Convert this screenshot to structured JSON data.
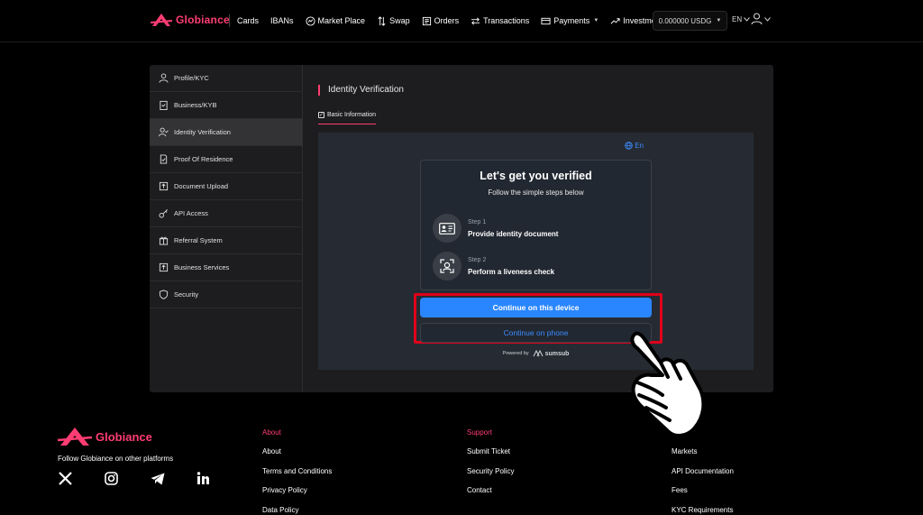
{
  "brand": {
    "name": "Globiance"
  },
  "nav": {
    "cards": "Cards",
    "ibans": "IBANs",
    "market_place": "Market Place",
    "swap": "Swap",
    "orders": "Orders",
    "transactions": "Transactions",
    "payments": "Payments",
    "investments": "Investments",
    "balance": "0.000000 USDG",
    "language": "EN"
  },
  "sidebar": {
    "items": [
      {
        "label": "Profile/KYC",
        "icon": "user-icon"
      },
      {
        "label": "Business/KYB",
        "icon": "clipboard-icon"
      },
      {
        "label": "Identity Verification",
        "icon": "user-check-icon"
      },
      {
        "label": "Proof Of Residence",
        "icon": "document-check-icon"
      },
      {
        "label": "Document Upload",
        "icon": "upload-icon"
      },
      {
        "label": "API Access",
        "icon": "key-icon"
      },
      {
        "label": "Referral System",
        "icon": "gift-icon"
      },
      {
        "label": "Business Services",
        "icon": "upload-icon"
      },
      {
        "label": "Security",
        "icon": "shield-icon"
      }
    ]
  },
  "content": {
    "title": "Identity Verification",
    "tab": "Basic Information"
  },
  "widget": {
    "language": "En",
    "title": "Let's get you verified",
    "subtitle": "Follow the simple steps below",
    "steps": [
      {
        "num": "Step 1",
        "text": "Provide identity document",
        "icon": "id-card-icon"
      },
      {
        "num": "Step 2",
        "text": "Perform a liveness check",
        "icon": "face-scan-icon"
      }
    ],
    "primary_button": "Continue on this device",
    "secondary_button": "Continue on phone",
    "powered_by": "Powered by",
    "powered_brand": "sumsub"
  },
  "colors": {
    "brand": "#ff3d73",
    "primary_button": "#2a86ff",
    "highlight": "#e0001a"
  },
  "footer": {
    "brand": "Globiance",
    "follow": "Follow Globiance on other platforms",
    "socials": [
      "x-icon",
      "instagram-icon",
      "telegram-icon",
      "linkedin-icon"
    ],
    "about": {
      "heading": "About",
      "links": [
        "About",
        "Terms and Conditions",
        "Privacy Policy",
        "Data Policy"
      ]
    },
    "support": {
      "heading": "Support",
      "links": [
        "Submit Ticket",
        "Security Policy",
        "Contact"
      ]
    },
    "services": {
      "links": [
        "Markets",
        "API Documentation",
        "Fees",
        "KYC Requirements"
      ]
    }
  }
}
